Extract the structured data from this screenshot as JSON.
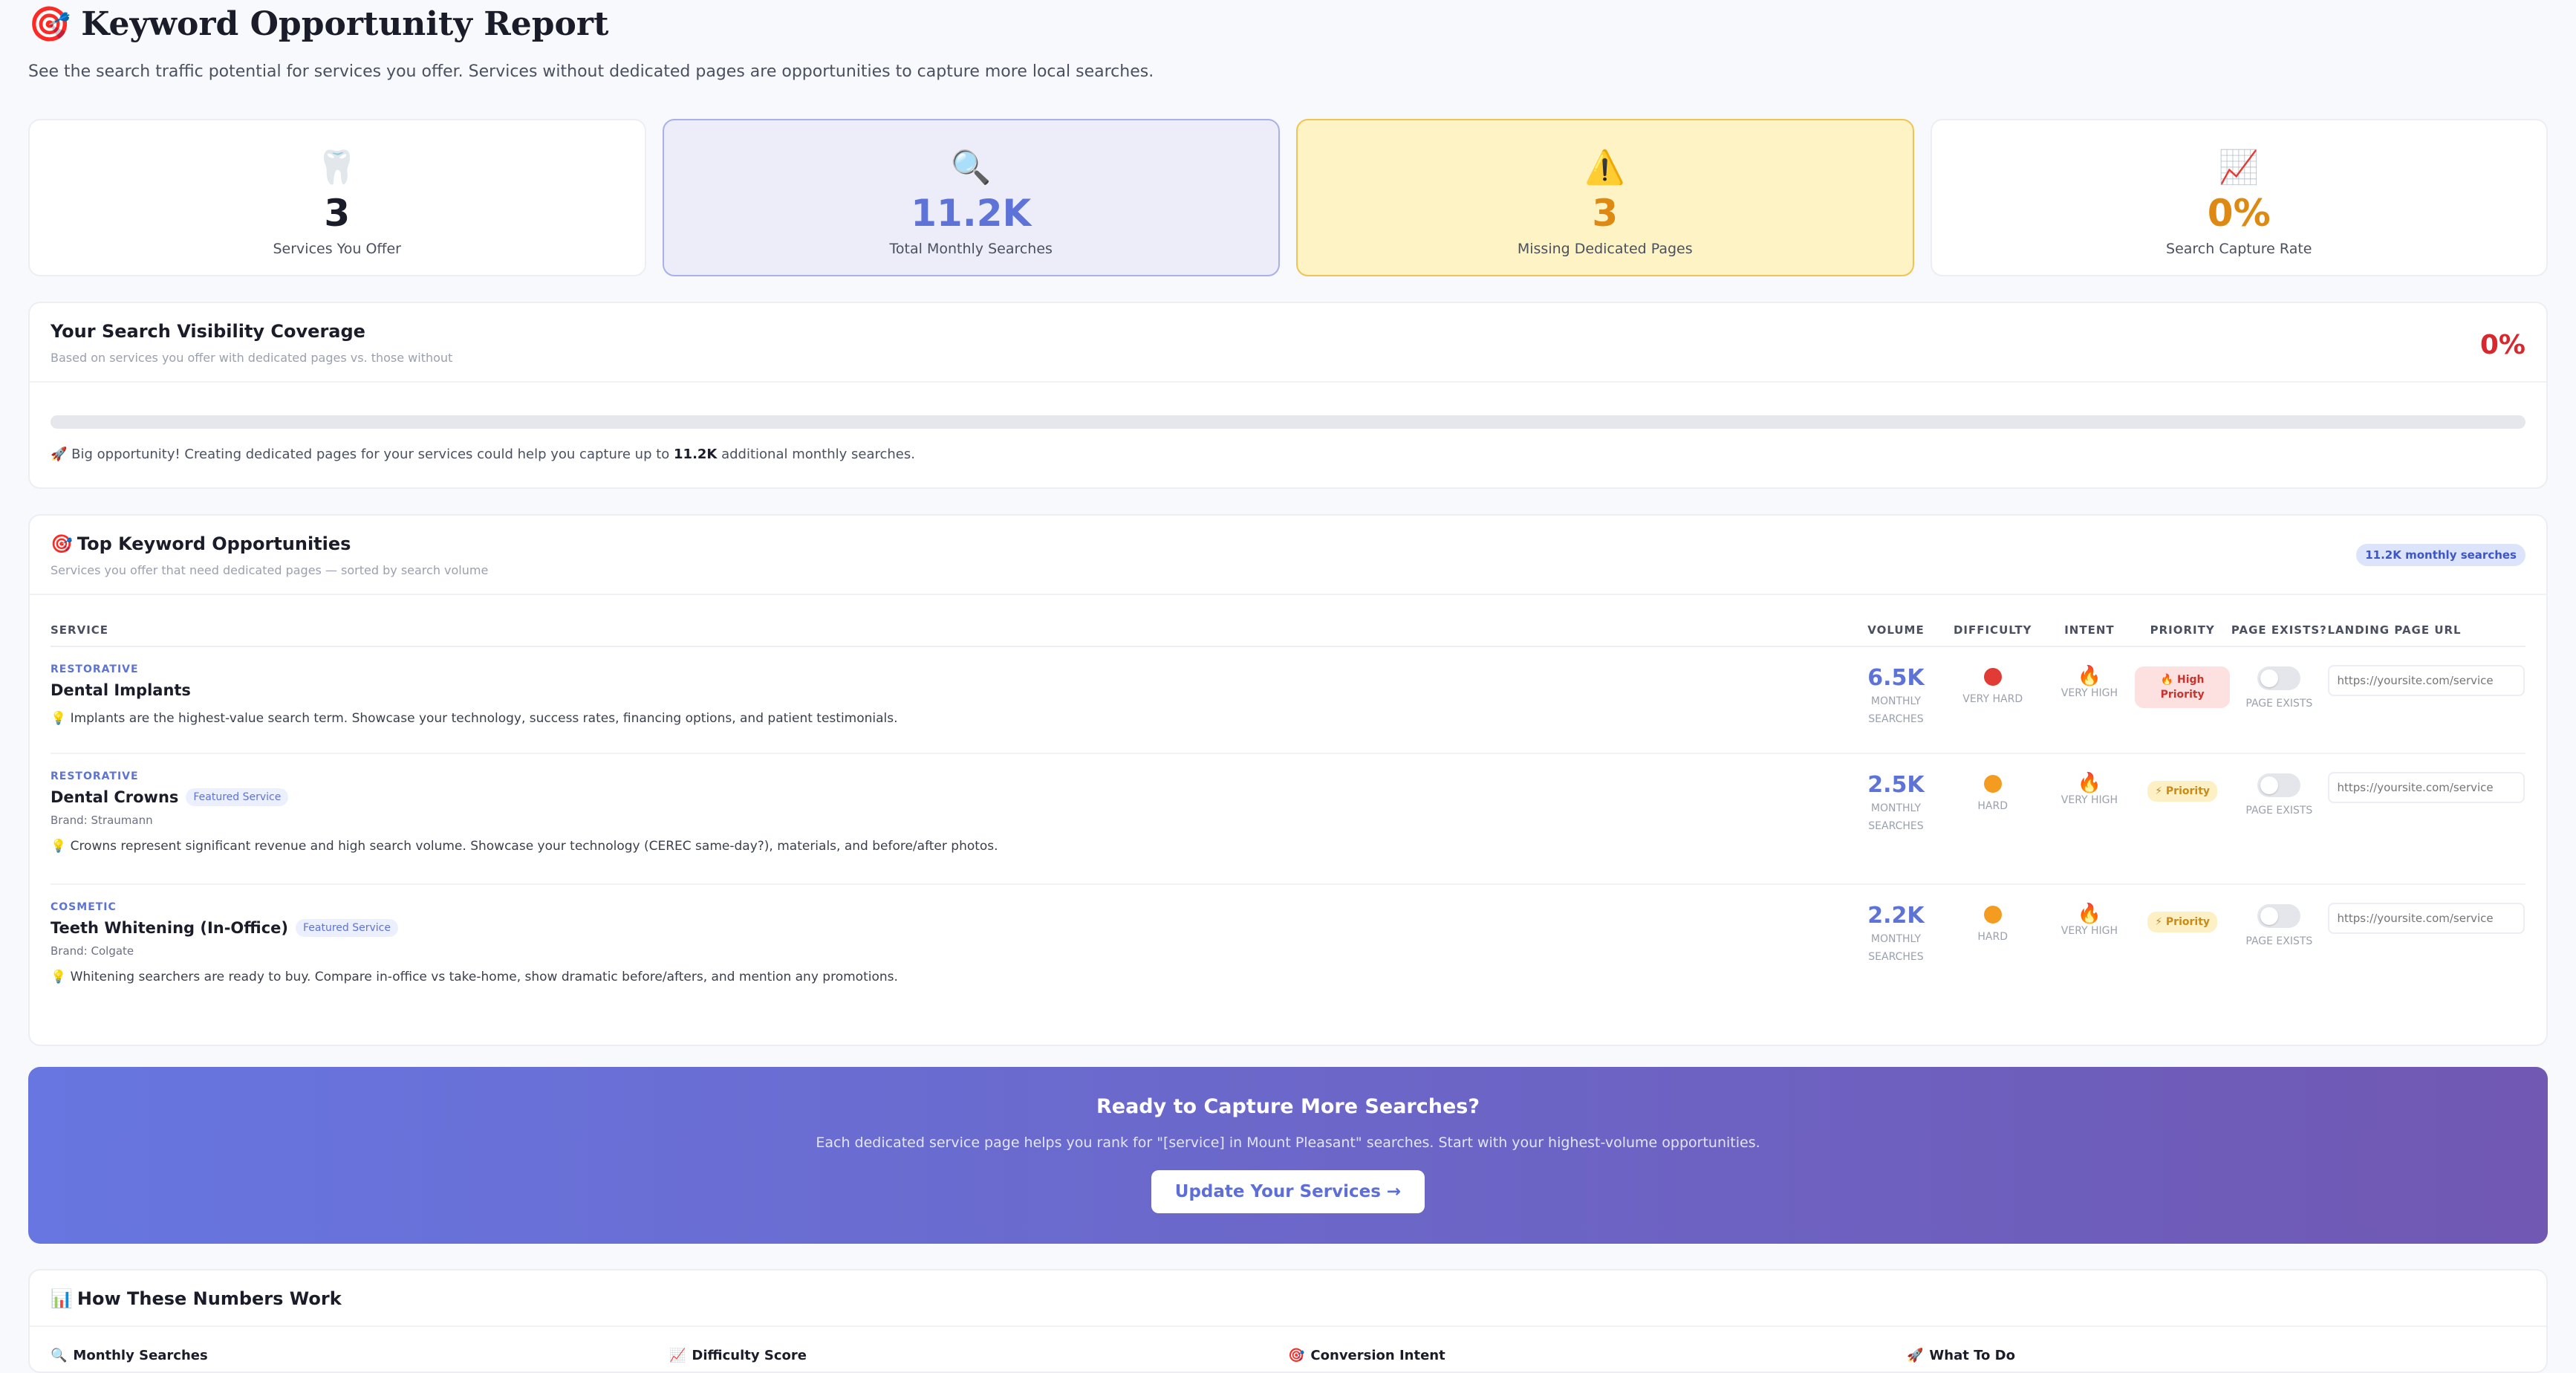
{
  "header": {
    "icon": "target-icon",
    "title": "Keyword Opportunity Report",
    "subtitle": "See the search traffic potential for services you offer. Services without dedicated pages are opportunities to capture more local searches."
  },
  "stats": [
    {
      "icon": "tooth-icon",
      "value": "3",
      "label": "Services You Offer"
    },
    {
      "icon": "magnifier-icon",
      "value": "11.2K",
      "label": "Total Monthly Searches"
    },
    {
      "icon": "warning-icon",
      "value": "3",
      "label": "Missing Dedicated Pages"
    },
    {
      "icon": "chart-up-icon",
      "value": "0%",
      "label": "Search Capture Rate"
    }
  ],
  "coverage": {
    "title": "Your Search Visibility Coverage",
    "subtitle": "Based on services you offer with dedicated pages vs. those without",
    "percent": "0%",
    "progress_fraction": 0,
    "note_prefix": "🚀 Big opportunity! Creating dedicated pages for your services could help you capture up to ",
    "note_value": "11.2K",
    "note_suffix": " additional monthly searches."
  },
  "opportunities": {
    "title": "Top Keyword Opportunities",
    "subtitle": "Services you offer that need dedicated pages — sorted by search volume",
    "badge": "11.2K monthly searches",
    "columns": {
      "service": "SERVICE",
      "volume": "VOLUME",
      "difficulty": "DIFFICULTY",
      "intent": "INTENT",
      "priority": "PRIORITY",
      "page_exists": "PAGE EXISTS?",
      "landing_url": "LANDING PAGE URL"
    },
    "volume_label_1": "MONTHLY",
    "volume_label_2": "SEARCHES",
    "page_exists_label": "PAGE EXISTS",
    "url_placeholder": "https://yoursite.com/service",
    "rows": [
      {
        "category": "RESTORATIVE",
        "name": "Dental Implants",
        "featured": "",
        "brand": "",
        "tip": "💡 Implants are the highest-value search term. Showcase your technology, success rates, financing options, and patient testimonials.",
        "volume": "6.5K",
        "difficulty": "VERY HARD",
        "difficulty_color": "#e23a34",
        "intent": "VERY HIGH",
        "priority": "🔥 High Priority",
        "priority_level": "high"
      },
      {
        "category": "RESTORATIVE",
        "name": "Dental Crowns",
        "featured": "Featured Service",
        "brand": "Brand: Straumann",
        "tip": "💡 Crowns represent significant revenue and high search volume. Showcase your technology (CEREC same-day?), materials, and before/after photos.",
        "volume": "2.5K",
        "difficulty": "HARD",
        "difficulty_color": "#f39c1f",
        "intent": "VERY HIGH",
        "priority": "⚡ Priority",
        "priority_level": "normal"
      },
      {
        "category": "COSMETIC",
        "name": "Teeth Whitening (In-Office)",
        "featured": "Featured Service",
        "brand": "Brand: Colgate",
        "tip": "💡 Whitening searchers are ready to buy. Compare in-office vs take-home, show dramatic before/afters, and mention any promotions.",
        "volume": "2.2K",
        "difficulty": "HARD",
        "difficulty_color": "#f39c1f",
        "intent": "VERY HIGH",
        "priority": "⚡ Priority",
        "priority_level": "normal"
      }
    ]
  },
  "cta": {
    "title": "Ready to Capture More Searches?",
    "subtitle": "Each dedicated service page helps you rank for \"[service] in Mount Pleasant\" searches. Start with your highest-volume opportunities.",
    "button": "Update Your Services →"
  },
  "how": {
    "title": "How These Numbers Work",
    "columns": [
      "Monthly Searches",
      "Difficulty Score",
      "Conversion Intent",
      "What To Do"
    ]
  },
  "colors": {
    "accent": "#5d73d8",
    "danger": "#d8282e",
    "warning": "#de8a12"
  }
}
